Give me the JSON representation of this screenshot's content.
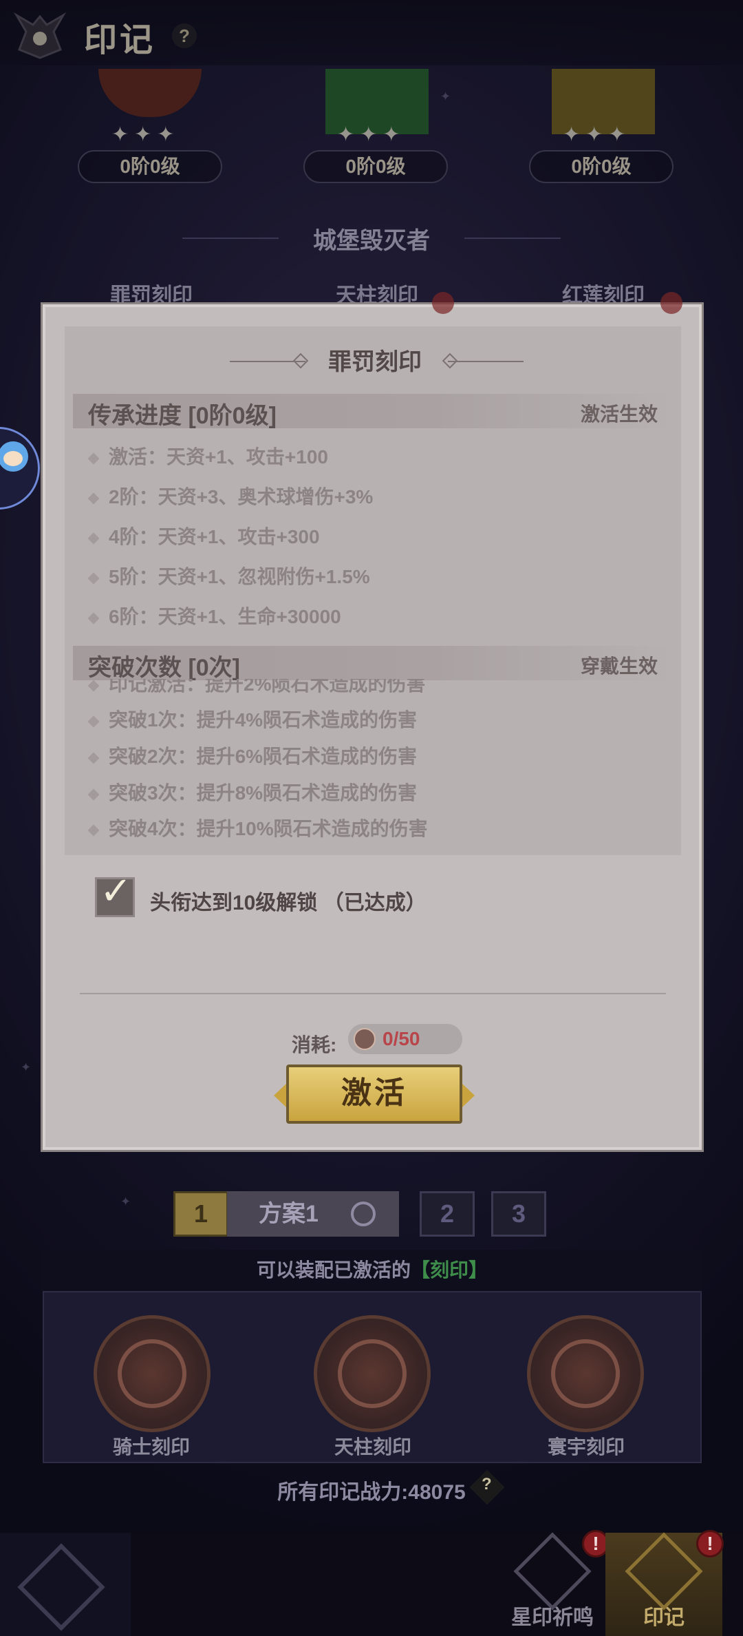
{
  "header": {
    "title": "印记",
    "help": "?"
  },
  "top_seals": [
    {
      "stars": "✦✦✦",
      "level": "0阶0级",
      "color": "#6e3128"
    },
    {
      "stars": "✦✦✦",
      "level": "0阶0级",
      "color": "#2f6e3a"
    },
    {
      "stars": "✦✦✦",
      "level": "0阶0级",
      "color": "#7d6a2a"
    }
  ],
  "section_title": "城堡毁灭者",
  "seal_names": [
    "罪罚刻印",
    "天柱刻印",
    "红莲刻印"
  ],
  "modal": {
    "title": "罪罚刻印",
    "inherit": {
      "title": "传承进度 [0阶0级]",
      "right": "激活生效",
      "rows": [
        "激活：天资+1、攻击+100",
        "2阶：天资+3、奥术球增伤+3%",
        "4阶：天资+1、攻击+300",
        "5阶：天资+1、忽视附伤+1.5%",
        "6阶：天资+1、生命+30000"
      ]
    },
    "breakthrough": {
      "title": "突破次数 [0次]",
      "right": "穿戴生效",
      "rows": [
        "印记激活：提升2%陨石术造成的伤害",
        "突破1次：提升4%陨石术造成的伤害",
        "突破2次：提升6%陨石术造成的伤害",
        "突破3次：提升8%陨石术造成的伤害",
        "突破4次：提升10%陨石术造成的伤害"
      ]
    },
    "unlock_text": "头衔达到10级解锁 （已达成）",
    "cost_label": "消耗:",
    "cost_value": "0/50",
    "activate_label": "激活"
  },
  "schemes": {
    "tabs": [
      "1",
      "2",
      "3"
    ],
    "current_name": "方案1"
  },
  "equip": {
    "header_prefix": "可以装配已激活的",
    "header_highlight": "【刻印】",
    "items": [
      "骑士刻印",
      "天柱刻印",
      "寰宇刻印"
    ]
  },
  "power_text": "所有印记战力:48075",
  "power_help": "?",
  "nav": {
    "items": [
      {
        "label": "星印祈鸣",
        "badge": "!"
      },
      {
        "label": "印记",
        "badge": "!"
      }
    ]
  }
}
